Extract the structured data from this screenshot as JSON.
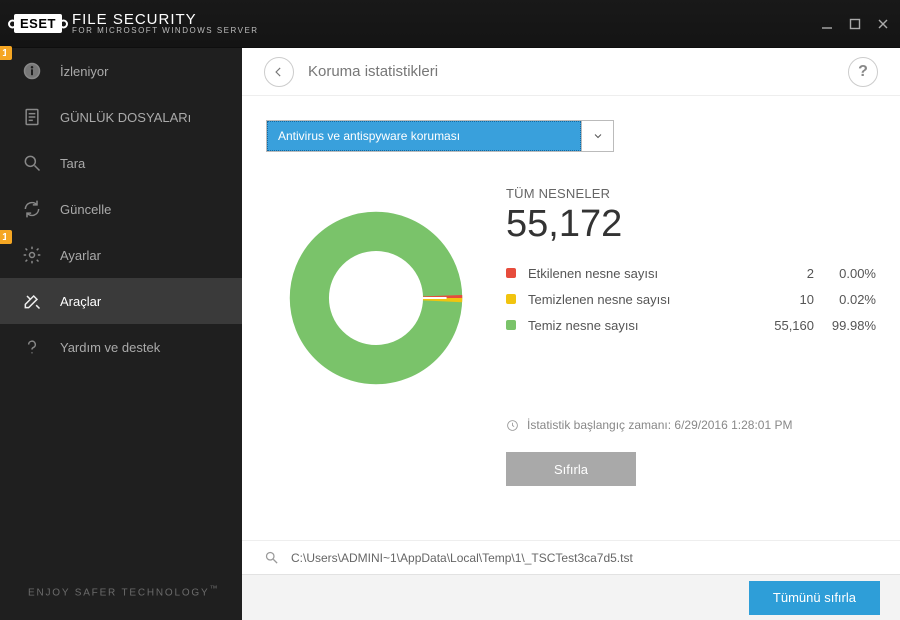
{
  "brand": {
    "logo": "ESET",
    "product_top": "FILE SECURITY",
    "product_bot": "FOR MICROSOFT WINDOWS SERVER"
  },
  "sidebar": {
    "items": [
      {
        "label": "İzleniyor",
        "badge": "1"
      },
      {
        "label": "GÜNLÜK DOSYALARı"
      },
      {
        "label": "Tara"
      },
      {
        "label": "Güncelle"
      },
      {
        "label": "Ayarlar",
        "badge": "1"
      },
      {
        "label": "Araçlar"
      },
      {
        "label": "Yardım ve destek"
      }
    ],
    "tagline": "ENJOY SAFER TECHNOLOGY",
    "tagline_tm": "™"
  },
  "header": {
    "title": "Koruma istatistikleri",
    "help": "?"
  },
  "dropdown": {
    "selected": "Antivirus ve antispyware koruması"
  },
  "stats": {
    "total_label": "TÜM NESNELER",
    "total": "55,172",
    "rows": [
      {
        "name": "Etkilenen nesne sayısı",
        "value": "2",
        "pct": "0.00%",
        "color": "#e74c3c"
      },
      {
        "name": "Temizlenen nesne sayısı",
        "value": "10",
        "pct": "0.02%",
        "color": "#f1c40f"
      },
      {
        "name": "Temiz nesne sayısı",
        "value": "55,160",
        "pct": "99.98%",
        "color": "#7ac36a"
      }
    ],
    "timestamp_label": "İstatistik başlangıç zamanı: 6/29/2016 1:28:01 PM",
    "reset_label": "Sıfırla"
  },
  "chart_data": {
    "type": "pie",
    "title": "",
    "series": [
      {
        "name": "Etkilenen nesne sayısı",
        "value": 2,
        "pct": 0.0,
        "color": "#e74c3c"
      },
      {
        "name": "Temizlenen nesne sayısı",
        "value": 10,
        "pct": 0.02,
        "color": "#f1c40f"
      },
      {
        "name": "Temiz nesne sayısı",
        "value": 55160,
        "pct": 99.98,
        "color": "#7ac36a"
      }
    ]
  },
  "pathbar": {
    "text": "C:\\Users\\ADMINI~1\\AppData\\Local\\Temp\\1\\_TSCTest3ca7d5.tst"
  },
  "footer": {
    "reset_all": "Tümünü sıfırla"
  }
}
